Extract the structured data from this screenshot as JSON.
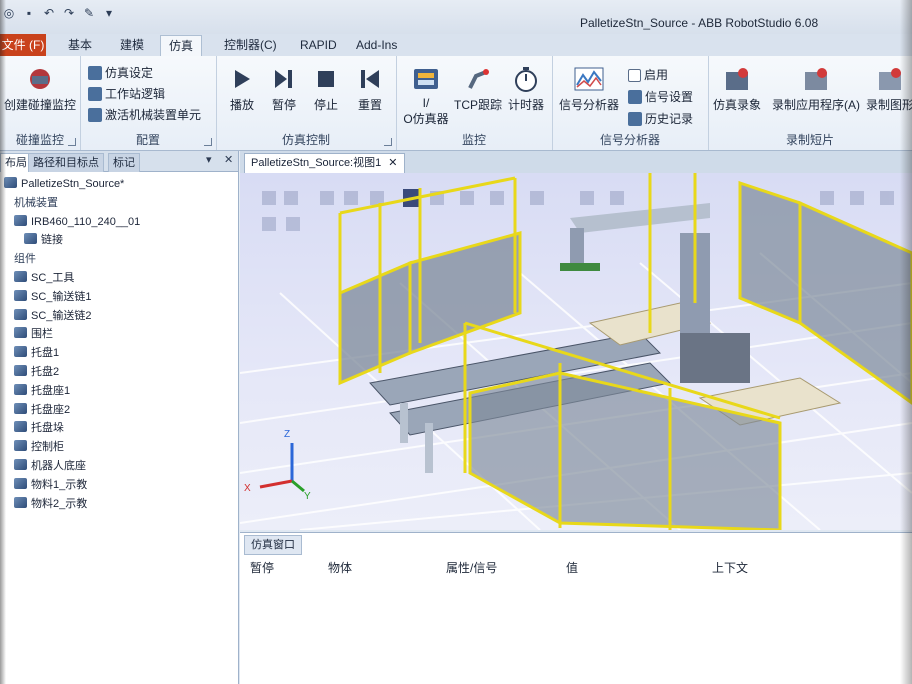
{
  "app": {
    "title": "PalletizeStn_Source - ABB RobotStudio 6.08"
  },
  "menu_tabs": [
    {
      "label": "文件 (F)"
    },
    {
      "label": "基本"
    },
    {
      "label": "建模"
    },
    {
      "label": "仿真"
    },
    {
      "label": "控制器(C)"
    },
    {
      "label": "RAPID"
    },
    {
      "label": "Add-Ins"
    }
  ],
  "ribbon": {
    "collision": {
      "button": "创建碰撞监控",
      "group": "碰撞监控"
    },
    "config": {
      "items": [
        "仿真设定",
        "工作站逻辑",
        "激活机械装置单元"
      ],
      "group": "配置"
    },
    "sim_control": {
      "buttons": [
        "播放",
        "暂停",
        "停止",
        "重置"
      ],
      "group": "仿真控制"
    },
    "monitor": {
      "buttons": [
        "I/\nO仿真器",
        "TCP跟踪",
        "计时器"
      ],
      "io_line1": "I/",
      "io_line2": "O仿真器",
      "group": "监控"
    },
    "signal_analyzer": {
      "button": "信号分析器",
      "items": [
        "启用",
        "信号设置",
        "历史记录"
      ],
      "group": "信号分析器"
    },
    "record": {
      "buttons": [
        "仿真录象",
        "录制应用程序(A)",
        "录制图形"
      ],
      "group": "录制短片"
    }
  },
  "left_panel": {
    "tabs": [
      "布局",
      "路径和目标点",
      "标记"
    ],
    "pin": "▾",
    "close": "✕",
    "tree": [
      {
        "label": "PalletizeStn_Source*",
        "indent": 0,
        "icon": "station-icon"
      },
      {
        "label": "机械装置",
        "indent": 1,
        "header": true
      },
      {
        "label": "IRB460_110_240__01",
        "indent": 1,
        "icon": "robot-icon"
      },
      {
        "label": "链接",
        "indent": 2,
        "icon": "folder-icon"
      },
      {
        "label": "组件",
        "indent": 1,
        "header": true
      },
      {
        "label": "SC_工具",
        "indent": 1,
        "icon": "component-icon"
      },
      {
        "label": "SC_输送链1",
        "indent": 1,
        "icon": "component-icon"
      },
      {
        "label": "SC_输送链2",
        "indent": 1,
        "icon": "component-icon"
      },
      {
        "label": "围栏",
        "indent": 1,
        "icon": "component-icon"
      },
      {
        "label": "托盘1",
        "indent": 1,
        "icon": "part-icon"
      },
      {
        "label": "托盘2",
        "indent": 1,
        "icon": "part-icon"
      },
      {
        "label": "托盘座1",
        "indent": 1,
        "icon": "part-icon"
      },
      {
        "label": "托盘座2",
        "indent": 1,
        "icon": "part-icon"
      },
      {
        "label": "托盘垛",
        "indent": 1,
        "icon": "part-icon"
      },
      {
        "label": "控制柜",
        "indent": 1,
        "icon": "part-icon"
      },
      {
        "label": "机器人底座",
        "indent": 1,
        "icon": "part-icon"
      },
      {
        "label": "物料1_示教",
        "indent": 1,
        "icon": "part-icon"
      },
      {
        "label": "物料2_示教",
        "indent": 1,
        "icon": "part-icon"
      }
    ]
  },
  "document": {
    "tab_label": "PalletizeStn_Source:视图1",
    "tab_close": "✕",
    "axis_labels": {
      "z": "Z",
      "x": "X",
      "y": "Y"
    }
  },
  "output": {
    "tab_label": "仿真窗口",
    "columns": [
      "暂停",
      "物体",
      "属性/信号",
      "值",
      "上下文"
    ]
  },
  "colors": {
    "file_tab": "#c9421c",
    "fence_yellow": "#e8d81a",
    "panel_gray": "#7e8a9a"
  }
}
